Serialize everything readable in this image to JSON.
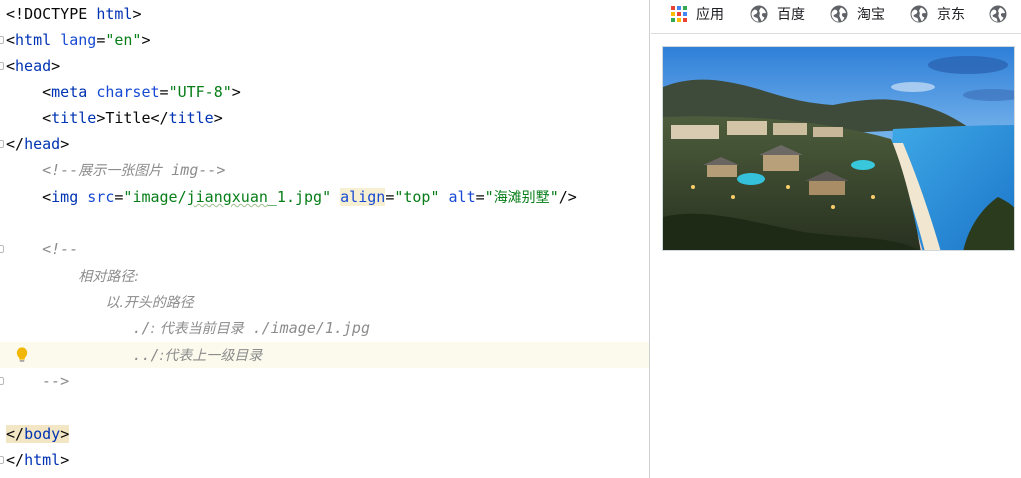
{
  "editor": {
    "line1": {
      "lt": "<!",
      "doctype": "DOCTYPE",
      "sp": " ",
      "html": "html",
      "gt": ">"
    },
    "line2": {
      "lt": "<",
      "tag": "html",
      "sp": " ",
      "attr": "lang",
      "eq": "=",
      "val": "\"en\"",
      "gt": ">"
    },
    "line3": {
      "lt": "<",
      "tag": "head",
      "gt": ">"
    },
    "line4": {
      "indent": "    ",
      "lt": "<",
      "tag": "meta",
      "sp": " ",
      "attr": "charset",
      "eq": "=",
      "val": "\"UTF-8\"",
      "gt": ">"
    },
    "line5": {
      "indent": "    ",
      "lt": "<",
      "tag": "title",
      "gt": ">",
      "text": "Title",
      "lt2": "</",
      "tag2": "title",
      "gt2": ">"
    },
    "line6": {
      "lt": "</",
      "tag": "head",
      "gt": ">"
    },
    "line7": {
      "indent": "    ",
      "open": "<!--",
      "cn": "展示一张图片",
      "sp": " ",
      "word": "img",
      "close": "-->"
    },
    "line8": {
      "indent": "    ",
      "lt": "<",
      "tag": "img",
      "sp1": " ",
      "attr1": "src",
      "eq1": "=",
      "q1": "\"",
      "val1a": "image/",
      "val1b": "jiangxuan",
      "val1c": "_1.jpg\"",
      "sp2": " ",
      "attr2": "align",
      "eq2": "=",
      "val2": "\"top\"",
      "sp3": " ",
      "attr3": "alt",
      "eq3": "=",
      "q3a": "\"",
      "val3": "海滩别墅",
      "q3b": "\"",
      "end": "/>"
    },
    "line10": {
      "indent": "    ",
      "text": "<!--"
    },
    "line11": {
      "indent": "        ",
      "text": "相对路径:"
    },
    "line12": {
      "indent": "           ",
      "text": "以.开头的路径"
    },
    "line13": {
      "indent": "              ",
      "a": "./",
      "b": ": 代表当前目录  ",
      "c": "./image/1.jpg"
    },
    "line14": {
      "indent": "              ",
      "a": "../",
      "b": ":代表上一级目录"
    },
    "line15": {
      "indent": "    ",
      "text": "-->"
    },
    "line17": {
      "lt": "</",
      "tag": "body",
      "gt": ">"
    },
    "line18": {
      "lt": "</",
      "tag": "html",
      "gt": ">"
    }
  },
  "browser": {
    "bookmarks": [
      {
        "label": "应用",
        "icon": "apps-grid-icon"
      },
      {
        "label": "百度",
        "icon": "globe-icon"
      },
      {
        "label": "淘宝",
        "icon": "globe-icon"
      },
      {
        "label": "京东",
        "icon": "globe-icon"
      },
      {
        "label": "",
        "icon": "globe-icon"
      }
    ],
    "image": {
      "alt": "海滩别墅"
    }
  },
  "colors": {
    "tag": "#0033b3",
    "attribute": "#174ad4",
    "string": "#067d17",
    "comment": "#8c8c8c",
    "current_line": "#fcfaed",
    "brace_match": "#f3e6c4"
  }
}
